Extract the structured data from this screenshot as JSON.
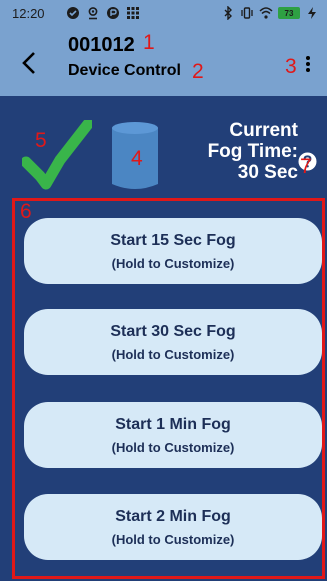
{
  "status_bar": {
    "time": "12:20",
    "battery": "73",
    "icons_left": [
      "check-circle-icon",
      "location-icon",
      "pocket-icon",
      "grid-icon"
    ],
    "icons_right": [
      "bluetooth-icon",
      "vibrate-icon",
      "wifi-icon",
      "battery-icon",
      "charging-icon"
    ]
  },
  "app_bar": {
    "title": "001012",
    "subtitle": "Device Control"
  },
  "annotations": {
    "a1": "1",
    "a2": "2",
    "a3": "3",
    "a4": "4",
    "a5": "5",
    "a6": "6",
    "a7": "7"
  },
  "fog_time": {
    "line1": "Current",
    "line2": "Fog Time:",
    "value": "30 Sec"
  },
  "buttons": [
    {
      "title": "Start 15 Sec Fog",
      "subtitle": "(Hold to Customize)"
    },
    {
      "title": "Start 30 Sec Fog",
      "subtitle": "(Hold to Customize)"
    },
    {
      "title": "Start 1 Min Fog",
      "subtitle": "(Hold to Customize)"
    },
    {
      "title": "Start 2 Min Fog",
      "subtitle": "(Hold to Customize)"
    }
  ],
  "colors": {
    "background": "#223f78",
    "header": "#7aa2cf",
    "button": "#d6e9f7",
    "check": "#39b54a",
    "annotation": "#e01818"
  }
}
